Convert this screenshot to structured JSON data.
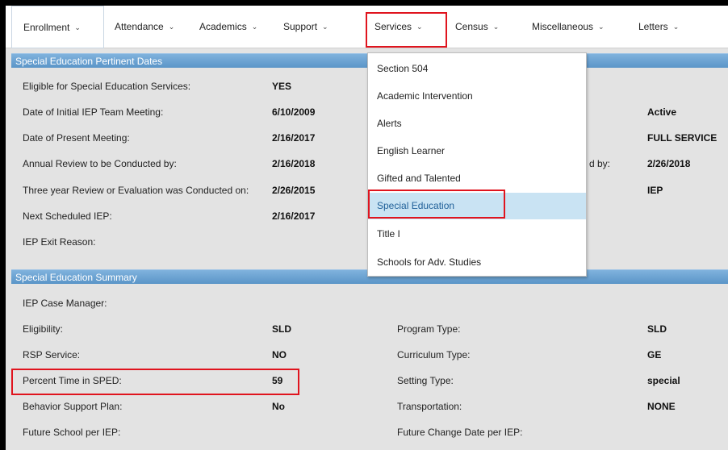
{
  "nav": {
    "items": [
      {
        "label": "Enrollment"
      },
      {
        "label": "Attendance"
      },
      {
        "label": "Academics"
      },
      {
        "label": "Support"
      },
      {
        "label": "Services"
      },
      {
        "label": "Census"
      },
      {
        "label": "Miscellaneous"
      },
      {
        "label": "Letters"
      }
    ]
  },
  "pertinent": {
    "title": "Special Education Pertinent Dates",
    "rows": [
      {
        "label": "Eligible for Special Education Services:",
        "value": "YES"
      },
      {
        "label": "Date of Initial IEP Team Meeting:",
        "value": "6/10/2009"
      },
      {
        "label": "Date of Present Meeting:",
        "value": "2/16/2017"
      },
      {
        "label": "Annual Review to be Conducted by:",
        "value": "2/16/2018"
      },
      {
        "label": "Three year Review or Evaluation was Conducted on:",
        "value": "2/26/2015"
      },
      {
        "label": "Next Scheduled IEP:",
        "value": "2/16/2017"
      },
      {
        "label": "IEP Exit Reason:",
        "value": ""
      }
    ],
    "right": [
      {
        "value": "Active"
      },
      {
        "value": "FULL SERVICE"
      },
      {
        "label": "d by:",
        "value": "2/26/2018"
      },
      {
        "value": "IEP"
      }
    ]
  },
  "summary": {
    "title": "Special Education Summary",
    "left": [
      {
        "label": "IEP Case Manager:",
        "value": ""
      },
      {
        "label": "Eligibility:",
        "value": "SLD"
      },
      {
        "label": "RSP Service:",
        "value": "NO"
      },
      {
        "label": "Percent Time in SPED:",
        "value": "59"
      },
      {
        "label": "Behavior Support Plan:",
        "value": "No"
      },
      {
        "label": "Future School per IEP:",
        "value": ""
      }
    ],
    "right": [
      {
        "label": "Program Type:",
        "value": "SLD"
      },
      {
        "label": "Curriculum Type:",
        "value": "GE"
      },
      {
        "label": "Setting Type:",
        "value": "special"
      },
      {
        "label": "Transportation:",
        "value": "NONE"
      },
      {
        "label": "Future Change Date per IEP:",
        "value": ""
      }
    ]
  },
  "dropdown": {
    "items": [
      {
        "label": "Section 504"
      },
      {
        "label": "Academic Intervention"
      },
      {
        "label": "Alerts"
      },
      {
        "label": "English Learner"
      },
      {
        "label": "Gifted and Talented"
      },
      {
        "label": "Special Education"
      },
      {
        "label": "Title I"
      },
      {
        "label": "Schools for Adv. Studies"
      }
    ]
  },
  "icons": {
    "chevron": "chevron-down-icon"
  },
  "colors": {
    "header_blue": "#5b95c8",
    "highlight_red": "#e0141e",
    "selected_bg": "#c9e3f3"
  }
}
